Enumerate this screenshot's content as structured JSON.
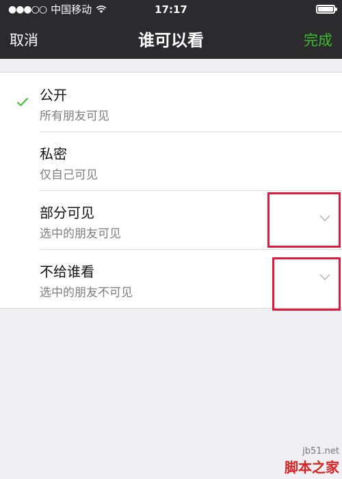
{
  "status_bar": {
    "signal": "●●●○○",
    "carrier": "中国移动",
    "time": "17:17"
  },
  "nav": {
    "left": "取消",
    "title": "谁可以看",
    "right": "完成"
  },
  "options": [
    {
      "title": "公开",
      "subtitle": "所有朋友可见",
      "selected": true
    },
    {
      "title": "私密",
      "subtitle": "仅自己可见",
      "selected": false
    },
    {
      "title": "部分可见",
      "subtitle": "选中的朋友可见",
      "selected": false
    },
    {
      "title": "不给谁看",
      "subtitle": "选中的朋友不可见",
      "selected": false
    }
  ],
  "watermark": {
    "site": "jb51.net",
    "name": "脚本之家"
  },
  "colors": {
    "accent": "#3cbd2f",
    "topbar": "#2b2b2e",
    "highlight": "#e01a3c"
  }
}
